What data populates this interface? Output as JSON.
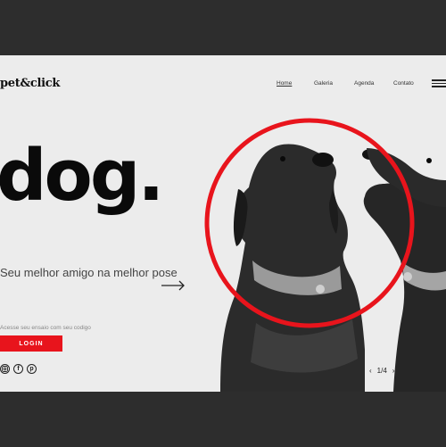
{
  "brand": {
    "logo_text": "pet&click"
  },
  "nav": {
    "items": [
      "Home",
      "Galeria",
      "Agenda",
      "Contato"
    ]
  },
  "hero": {
    "headline": "dog.",
    "tagline": "Seu melhor amigo na melhor pose",
    "access_hint": "Acesse seu ensaio com seu codigo",
    "login_label": "LOGIN"
  },
  "social": {
    "icons": [
      "instagram-icon",
      "facebook-icon",
      "pinterest-icon"
    ]
  },
  "pager": {
    "prev": "‹",
    "indicator": "1/4",
    "next": "›"
  },
  "colors": {
    "accent": "#e8141c",
    "background": "#ececec",
    "frame": "#2d2d2d",
    "text": "#0a0a0a"
  }
}
